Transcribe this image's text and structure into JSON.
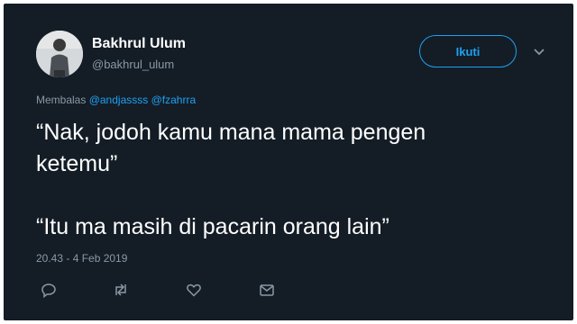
{
  "tweet": {
    "author_name": "Bakhrul Ulum",
    "author_handle": "@bakhrul_ulum",
    "follow_label": "Ikuti",
    "reply_prefix": "Membalas",
    "reply_mentions": [
      "@andjassss",
      "@fzahrra"
    ],
    "text_lines": [
      "“Nak, jodoh kamu mana mama pengen",
      "ketemu”",
      "“Itu ma masih di pacarin orang lain”"
    ],
    "timestamp": "20.43 - 4 Feb 2019",
    "actions": [
      "reply-icon",
      "retweet-icon",
      "like-icon",
      "message-icon"
    ]
  },
  "colors": {
    "background": "#141d26",
    "accent": "#1da1f2",
    "secondary_text": "#8899a6",
    "primary_text": "#ffffff"
  }
}
